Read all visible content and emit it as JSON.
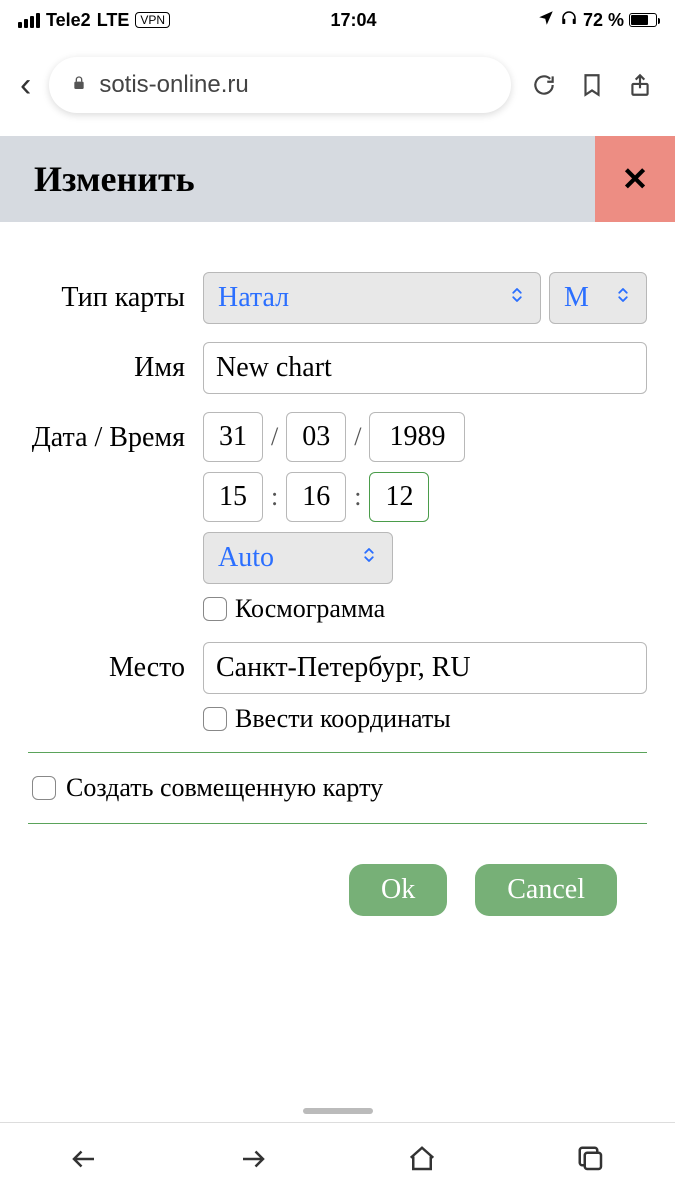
{
  "status": {
    "carrier": "Tele2",
    "network": "LTE",
    "vpn": "VPN",
    "time": "17:04",
    "battery_pct": "72 %"
  },
  "browser": {
    "url": "sotis-online.ru"
  },
  "modal": {
    "title": "Изменить",
    "close_glyph": "✕"
  },
  "form": {
    "labels": {
      "chart_type": "Тип карты",
      "name": "Имя",
      "datetime": "Дата / Время",
      "place": "Место"
    },
    "chart_type_value": "Натал",
    "gender_value": "М",
    "name_value": "New chart",
    "date": {
      "day": "31",
      "month": "03",
      "year": "1989"
    },
    "time": {
      "hour": "15",
      "minute": "16",
      "second": "12"
    },
    "tz_value": "Auto",
    "cosmogram_label": "Космограмма",
    "place_value": "Санкт-Петербург, RU",
    "coords_label": "Ввести координаты",
    "combined_label": "Создать совмещенную карту"
  },
  "buttons": {
    "ok": "Ok",
    "cancel": "Cancel"
  }
}
